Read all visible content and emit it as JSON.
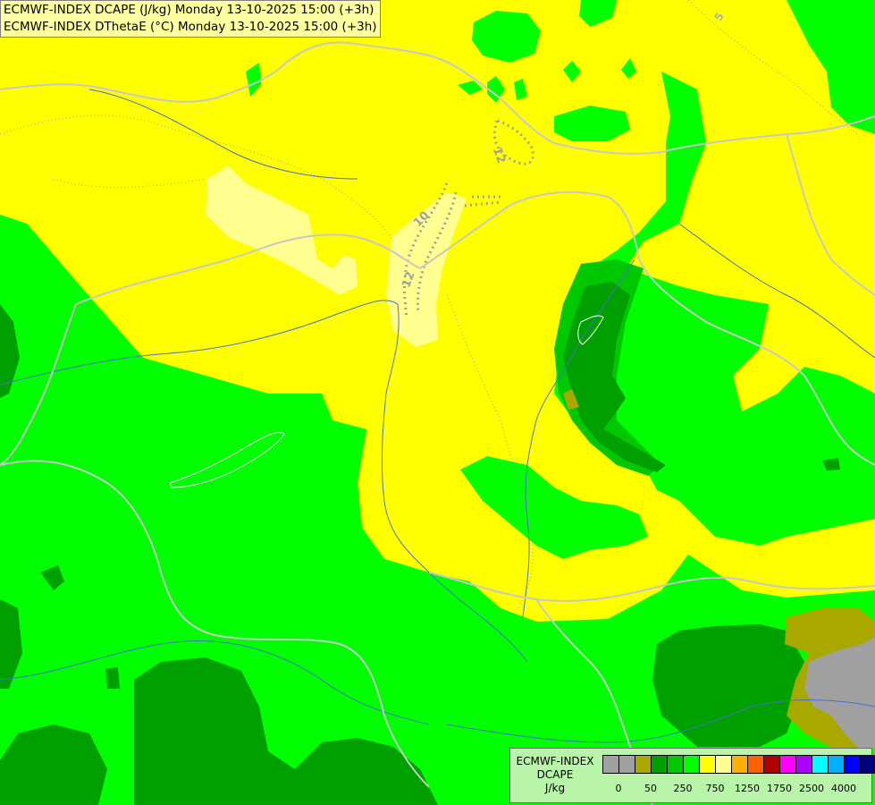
{
  "title": {
    "line1": "ECMWF-INDEX DCAPE (J/kg) Monday 13-10-2025 15:00 (+3h)",
    "line2": "ECMWF-INDEX DThetaE (°C) Monday 13-10-2025 15:00 (+3h)"
  },
  "legend": {
    "name": "ECMWF-INDEX",
    "variable": "DCAPE",
    "unit": "J/kg",
    "colors": [
      "#a0a0a0",
      "#a0a0a0",
      "#a8a800",
      "#00a000",
      "#00c800",
      "#00ff00",
      "#ffff00",
      "#ffff90",
      "#ffb000",
      "#ff6000",
      "#b00000",
      "#ff00ff",
      "#b000ff",
      "#00ffff",
      "#00b0ff",
      "#0000ff",
      "#000080"
    ],
    "ticks": [
      {
        "label": "0",
        "index": 1
      },
      {
        "label": "50",
        "index": 3
      },
      {
        "label": "250",
        "index": 5
      },
      {
        "label": "750",
        "index": 7
      },
      {
        "label": "1250",
        "index": 9
      },
      {
        "label": "1750",
        "index": 11
      },
      {
        "label": "2500",
        "index": 13
      },
      {
        "label": "4000",
        "index": 15
      }
    ]
  },
  "contour_labels": [
    "5",
    "12",
    "10",
    "12"
  ],
  "colors": {
    "yellow": "#ffff00",
    "light_yellow": "#ffff90",
    "green": "#00ff00",
    "mid_green": "#00c800",
    "dark_green": "#00a000",
    "olive": "#a8a800",
    "gray": "#a0a0a0",
    "border": "#c8c8c8",
    "river": "#4a70c8"
  }
}
